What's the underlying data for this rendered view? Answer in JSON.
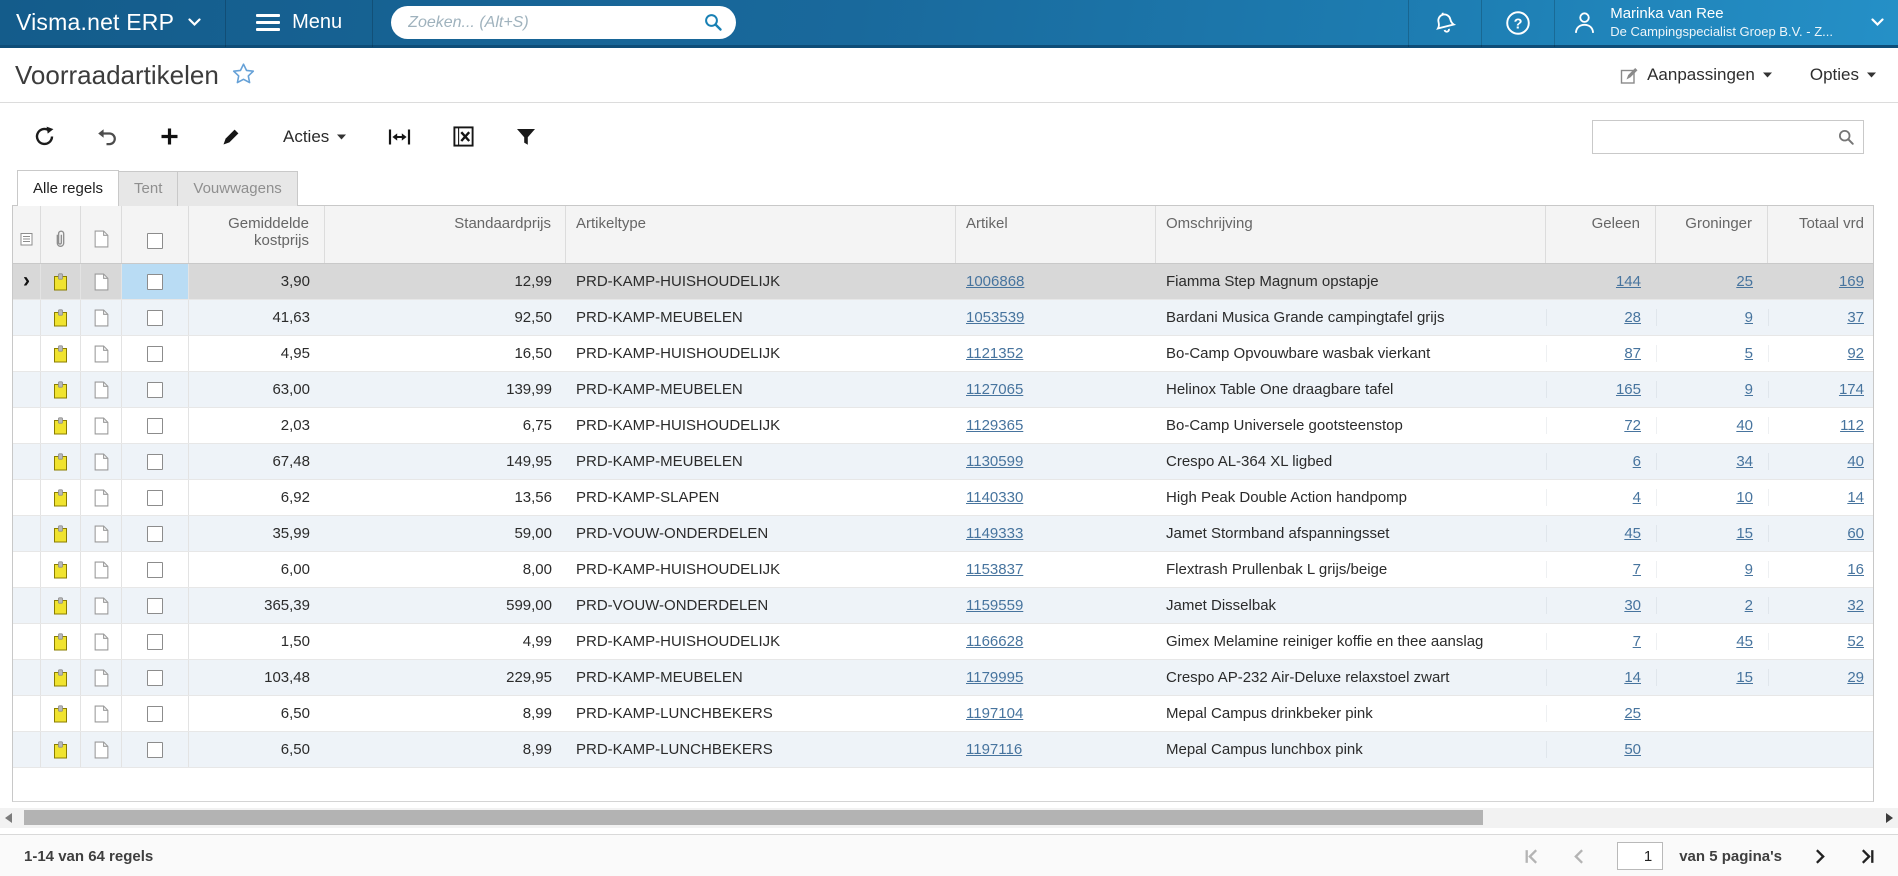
{
  "topbar": {
    "brand": "Visma.net ERP",
    "menu_label": "Menu",
    "search_placeholder": "Zoeken... (Alt+S)",
    "user_name": "Marinka van Ree",
    "user_org": "De Campingspecialist Groep B.V. - Z..."
  },
  "header": {
    "page_title": "Voorraadartikelen",
    "aanpassingen_label": "Aanpassingen",
    "opties_label": "Opties"
  },
  "toolbar": {
    "acties_label": "Acties"
  },
  "tabs": [
    {
      "label": "Alle regels",
      "active": true
    },
    {
      "label": "Tent",
      "active": false
    },
    {
      "label": "Vouwwagens",
      "active": false
    }
  ],
  "table": {
    "headers": {
      "kostprijs": "Gemiddelde kostprijs",
      "standaard": "Standaardprijs",
      "type": "Artikeltype",
      "artikel": "Artikel",
      "omschrijving": "Omschrijving",
      "geleen": "Geleen",
      "groninger": "Groninger",
      "totaal": "Totaal vrd"
    },
    "rows": [
      {
        "selected": true,
        "kostprijs": "3,90",
        "standaard": "12,99",
        "type": "PRD-KAMP-HUISHOUDELIJK",
        "artikel": "1006868",
        "omschrijving": "Fiamma Step Magnum opstapje",
        "geleen": "144",
        "groninger": "25",
        "totaal": "169"
      },
      {
        "selected": false,
        "kostprijs": "41,63",
        "standaard": "92,50",
        "type": "PRD-KAMP-MEUBELEN",
        "artikel": "1053539",
        "omschrijving": "Bardani Musica Grande campingtafel grijs",
        "geleen": "28",
        "groninger": "9",
        "totaal": "37"
      },
      {
        "selected": false,
        "kostprijs": "4,95",
        "standaard": "16,50",
        "type": "PRD-KAMP-HUISHOUDELIJK",
        "artikel": "1121352",
        "omschrijving": "Bo-Camp Opvouwbare wasbak vierkant",
        "geleen": "87",
        "groninger": "5",
        "totaal": "92"
      },
      {
        "selected": false,
        "kostprijs": "63,00",
        "standaard": "139,99",
        "type": "PRD-KAMP-MEUBELEN",
        "artikel": "1127065",
        "omschrijving": "Helinox Table One draagbare tafel",
        "geleen": "165",
        "groninger": "9",
        "totaal": "174"
      },
      {
        "selected": false,
        "kostprijs": "2,03",
        "standaard": "6,75",
        "type": "PRD-KAMP-HUISHOUDELIJK",
        "artikel": "1129365",
        "omschrijving": "Bo-Camp Universele gootsteenstop",
        "geleen": "72",
        "groninger": "40",
        "totaal": "112"
      },
      {
        "selected": false,
        "kostprijs": "67,48",
        "standaard": "149,95",
        "type": "PRD-KAMP-MEUBELEN",
        "artikel": "1130599",
        "omschrijving": "Crespo AL-364 XL ligbed",
        "geleen": "6",
        "groninger": "34",
        "totaal": "40"
      },
      {
        "selected": false,
        "kostprijs": "6,92",
        "standaard": "13,56",
        "type": "PRD-KAMP-SLAPEN",
        "artikel": "1140330",
        "omschrijving": "High Peak Double Action handpomp",
        "geleen": "4",
        "groninger": "10",
        "totaal": "14"
      },
      {
        "selected": false,
        "kostprijs": "35,99",
        "standaard": "59,00",
        "type": "PRD-VOUW-ONDERDELEN",
        "artikel": "1149333",
        "omschrijving": "Jamet Stormband afspanningsset",
        "geleen": "45",
        "groninger": "15",
        "totaal": "60"
      },
      {
        "selected": false,
        "kostprijs": "6,00",
        "standaard": "8,00",
        "type": "PRD-KAMP-HUISHOUDELIJK",
        "artikel": "1153837",
        "omschrijving": "Flextrash Prullenbak L grijs/beige",
        "geleen": "7",
        "groninger": "9",
        "totaal": "16"
      },
      {
        "selected": false,
        "kostprijs": "365,39",
        "standaard": "599,00",
        "type": "PRD-VOUW-ONDERDELEN",
        "artikel": "1159559",
        "omschrijving": "Jamet Disselbak",
        "geleen": "30",
        "groninger": "2",
        "totaal": "32"
      },
      {
        "selected": false,
        "kostprijs": "1,50",
        "standaard": "4,99",
        "type": "PRD-KAMP-HUISHOUDELIJK",
        "artikel": "1166628",
        "omschrijving": "Gimex Melamine reiniger koffie en thee aanslag",
        "geleen": "7",
        "groninger": "45",
        "totaal": "52"
      },
      {
        "selected": false,
        "kostprijs": "103,48",
        "standaard": "229,95",
        "type": "PRD-KAMP-MEUBELEN",
        "artikel": "1179995",
        "omschrijving": "Crespo AP-232 Air-Deluxe relaxstoel zwart",
        "geleen": "14",
        "groninger": "15",
        "totaal": "29"
      },
      {
        "selected": false,
        "kostprijs": "6,50",
        "standaard": "8,99",
        "type": "PRD-KAMP-LUNCHBEKERS",
        "artikel": "1197104",
        "omschrijving": "Mepal Campus drinkbeker pink",
        "geleen": "25",
        "groninger": "",
        "totaal": ""
      },
      {
        "selected": false,
        "kostprijs": "6,50",
        "standaard": "8,99",
        "type": "PRD-KAMP-LUNCHBEKERS",
        "artikel": "1197116",
        "omschrijving": "Mepal Campus lunchbox pink",
        "geleen": "50",
        "groninger": "",
        "totaal": ""
      }
    ]
  },
  "footer": {
    "records_label": "1-14 van 64 regels",
    "page_value": "1",
    "pages_label": "van 5 pagina's"
  },
  "icons": {
    "row_arrow": "›"
  },
  "colors": {
    "topbar_blue": "#19699c",
    "topbar_blue_light": "#2590c7",
    "link": "#47749e",
    "selected_row": "#d8d8d8",
    "selected_checkbox_cell": "#b9dcf4",
    "alt_row": "#eef3f8",
    "attachment_yellow": "#f0e32f"
  }
}
